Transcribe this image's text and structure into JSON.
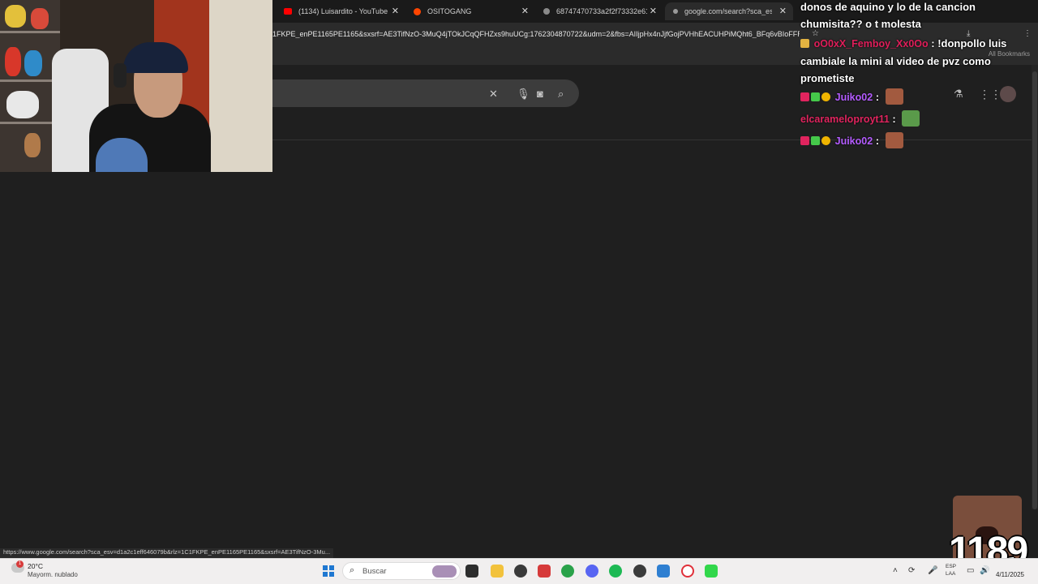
{
  "browser": {
    "tabs": [
      {
        "title": "(1134) Luisardito - YouTube",
        "icon": "youtube-icon"
      },
      {
        "title": "OSITOGANG",
        "icon": "reddit-icon"
      },
      {
        "title": "68747470733a2f2f73332e616d",
        "icon": "globe-icon"
      },
      {
        "title": "google.com/search?sca_esv=d",
        "icon": "google-icon"
      }
    ],
    "url": "1FKPE_enPE1165PE1165&sxsrf=AE3TifNzO-3MuQ4jTOkJCqQFHZxs9huUCg:1762304870722&udm=2&fbs=AIIjpHx4nJjfGojPVHhEACUHPiMQht6_BFq6vBIoFFR...",
    "all_bookmarks": "All Bookmarks",
    "status_url": "https://www.google.com/search?sca_esv=d1a2c1eff646079b&rlz=1C1FKPE_enPE1165PE1165&sxsrf=AE3TifNzO-3Mu..."
  },
  "chat": {
    "messages": [
      {
        "text": "donos de aquino y lo de la cancion chumisita?? o t molesta"
      },
      {
        "user": "oO0xX_Femboy_Xx0Oo",
        "user_color": "#e01e5a",
        "text": " : !donpollo luis cambiale la mini al video de pvz como prometiste"
      },
      {
        "user": "Juiko02",
        "user_color": "#b45cff",
        "sep": " :"
      },
      {
        "user": "elcarameloproyt11",
        "user_color": "#e0245e",
        "sep": " :"
      },
      {
        "user": "Juiko02",
        "user_color": "#b45cff",
        "sep": " :"
      }
    ]
  },
  "overlay": {
    "counter": "1189"
  },
  "taskbar": {
    "temperature": "20°C",
    "condition": "Mayorm. nublado",
    "weather_badge": "1",
    "search_placeholder": "Buscar",
    "lang_top": "ESP",
    "lang_bottom": "LAA",
    "date": "4/11/2025"
  }
}
